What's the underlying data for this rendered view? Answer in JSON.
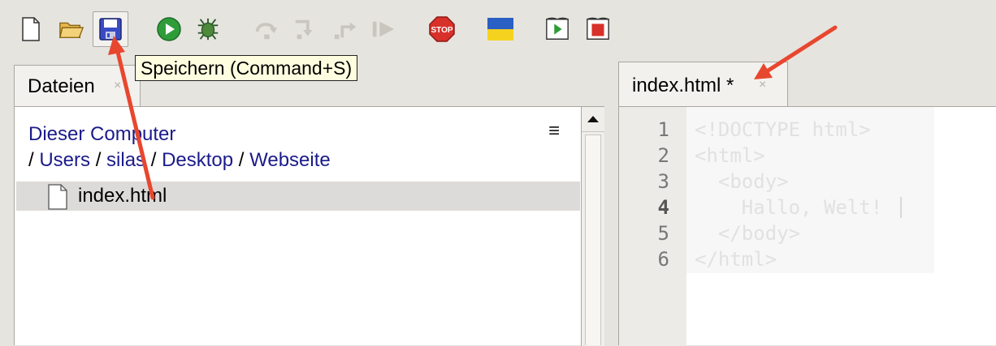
{
  "toolbar": {
    "buttons": [
      {
        "name": "new-file-icon"
      },
      {
        "name": "open-folder-icon"
      },
      {
        "name": "save-icon"
      },
      {
        "name": "run-icon"
      },
      {
        "name": "debug-bug-icon"
      },
      {
        "name": "step-over-icon"
      },
      {
        "name": "step-into-icon"
      },
      {
        "name": "step-out-icon"
      },
      {
        "name": "resume-icon"
      },
      {
        "name": "stop-icon",
        "label": "STOP"
      },
      {
        "name": "ukraine-flag-icon"
      },
      {
        "name": "run-in-terminal-icon"
      },
      {
        "name": "stop-in-terminal-icon"
      }
    ]
  },
  "tooltip": {
    "text": "Speichern (Command+S)"
  },
  "files_panel": {
    "tab_label": "Dateien",
    "tab_close": "×",
    "breadcrumb": {
      "root": "Dieser Computer",
      "separator": "/",
      "parts": [
        "Users",
        "silas",
        "Desktop",
        "Webseite"
      ]
    },
    "menu_glyph": "≡",
    "files": [
      {
        "name": "index.html"
      }
    ]
  },
  "editor": {
    "tab_label": "index.html *",
    "tab_close": "×",
    "line_numbers": [
      "1",
      "2",
      "3",
      "4",
      "5",
      "6"
    ],
    "lines": [
      "<!DOCTYPE html>",
      "<html>",
      "  <body>",
      "    Hallo, Welt!",
      "  </body>",
      "</html>"
    ]
  },
  "colors": {
    "annotation_arrow": "#e8472f",
    "link_blue": "#1b1b8a",
    "tooltip_bg": "#fffde0"
  }
}
